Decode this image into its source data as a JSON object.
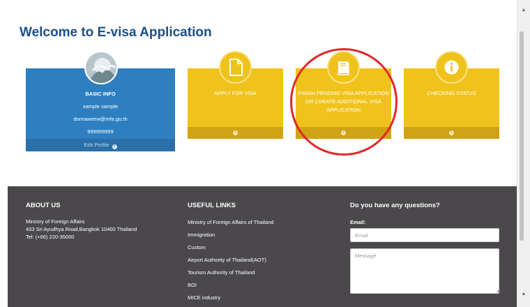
{
  "page_title": "Welcome to E-visa Application",
  "profile": {
    "heading": "BASIC INFO",
    "name": "sample sample",
    "email": "donraweew@mfa.go.th",
    "phone": "999999999",
    "edit_label": "Edit Profile"
  },
  "cards": [
    {
      "label": "APPLY FOR VISA",
      "icon": "document-icon"
    },
    {
      "label": "FINISH PENDING VISA APPLICATION OR CREATE ADDITIONAL VISA APPLICATION",
      "icon": "book-icon"
    },
    {
      "label": "CHECKING STATUS",
      "icon": "info-icon"
    }
  ],
  "footer": {
    "about": {
      "heading": "ABOUT US",
      "line1": "Ministry of Foreign Affairs",
      "line2": "433 Sri Ayudhya Road,Bangkok 10400 Thailand",
      "line3": "Tel: (+66) 220-35000"
    },
    "links": {
      "heading": "USEFUL LINKS",
      "items": [
        "Ministry of Foreign Affairs of Thailand",
        "Immigration",
        "Custom",
        "Airport Authority of Thailand(AOT)",
        "Tourism Authority of Thailand",
        "BOI",
        "MICE industry"
      ]
    },
    "contact": {
      "heading": "Do you have any questions?",
      "email_label": "Email:",
      "email_placeholder": "Email",
      "message_placeholder": "Message"
    }
  },
  "colors": {
    "title": "#1a4f8b",
    "info_card": "#2d7fc0",
    "action_card": "#f0c31c",
    "footer_bg": "#4a484b",
    "highlight": "#e3262b"
  }
}
